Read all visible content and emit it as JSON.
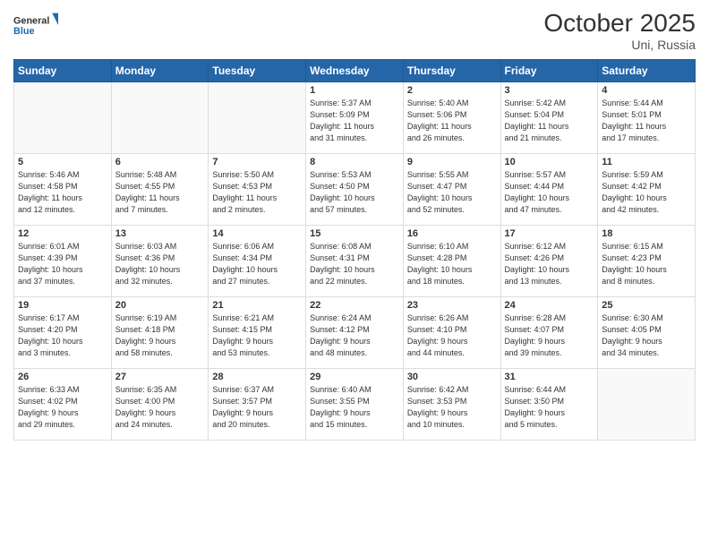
{
  "header": {
    "logo_general": "General",
    "logo_blue": "Blue",
    "month_title": "October 2025",
    "subtitle": "Uni, Russia"
  },
  "weekdays": [
    "Sunday",
    "Monday",
    "Tuesday",
    "Wednesday",
    "Thursday",
    "Friday",
    "Saturday"
  ],
  "weeks": [
    [
      {
        "day": "",
        "info": ""
      },
      {
        "day": "",
        "info": ""
      },
      {
        "day": "",
        "info": ""
      },
      {
        "day": "1",
        "info": "Sunrise: 5:37 AM\nSunset: 5:09 PM\nDaylight: 11 hours\nand 31 minutes."
      },
      {
        "day": "2",
        "info": "Sunrise: 5:40 AM\nSunset: 5:06 PM\nDaylight: 11 hours\nand 26 minutes."
      },
      {
        "day": "3",
        "info": "Sunrise: 5:42 AM\nSunset: 5:04 PM\nDaylight: 11 hours\nand 21 minutes."
      },
      {
        "day": "4",
        "info": "Sunrise: 5:44 AM\nSunset: 5:01 PM\nDaylight: 11 hours\nand 17 minutes."
      }
    ],
    [
      {
        "day": "5",
        "info": "Sunrise: 5:46 AM\nSunset: 4:58 PM\nDaylight: 11 hours\nand 12 minutes."
      },
      {
        "day": "6",
        "info": "Sunrise: 5:48 AM\nSunset: 4:55 PM\nDaylight: 11 hours\nand 7 minutes."
      },
      {
        "day": "7",
        "info": "Sunrise: 5:50 AM\nSunset: 4:53 PM\nDaylight: 11 hours\nand 2 minutes."
      },
      {
        "day": "8",
        "info": "Sunrise: 5:53 AM\nSunset: 4:50 PM\nDaylight: 10 hours\nand 57 minutes."
      },
      {
        "day": "9",
        "info": "Sunrise: 5:55 AM\nSunset: 4:47 PM\nDaylight: 10 hours\nand 52 minutes."
      },
      {
        "day": "10",
        "info": "Sunrise: 5:57 AM\nSunset: 4:44 PM\nDaylight: 10 hours\nand 47 minutes."
      },
      {
        "day": "11",
        "info": "Sunrise: 5:59 AM\nSunset: 4:42 PM\nDaylight: 10 hours\nand 42 minutes."
      }
    ],
    [
      {
        "day": "12",
        "info": "Sunrise: 6:01 AM\nSunset: 4:39 PM\nDaylight: 10 hours\nand 37 minutes."
      },
      {
        "day": "13",
        "info": "Sunrise: 6:03 AM\nSunset: 4:36 PM\nDaylight: 10 hours\nand 32 minutes."
      },
      {
        "day": "14",
        "info": "Sunrise: 6:06 AM\nSunset: 4:34 PM\nDaylight: 10 hours\nand 27 minutes."
      },
      {
        "day": "15",
        "info": "Sunrise: 6:08 AM\nSunset: 4:31 PM\nDaylight: 10 hours\nand 22 minutes."
      },
      {
        "day": "16",
        "info": "Sunrise: 6:10 AM\nSunset: 4:28 PM\nDaylight: 10 hours\nand 18 minutes."
      },
      {
        "day": "17",
        "info": "Sunrise: 6:12 AM\nSunset: 4:26 PM\nDaylight: 10 hours\nand 13 minutes."
      },
      {
        "day": "18",
        "info": "Sunrise: 6:15 AM\nSunset: 4:23 PM\nDaylight: 10 hours\nand 8 minutes."
      }
    ],
    [
      {
        "day": "19",
        "info": "Sunrise: 6:17 AM\nSunset: 4:20 PM\nDaylight: 10 hours\nand 3 minutes."
      },
      {
        "day": "20",
        "info": "Sunrise: 6:19 AM\nSunset: 4:18 PM\nDaylight: 9 hours\nand 58 minutes."
      },
      {
        "day": "21",
        "info": "Sunrise: 6:21 AM\nSunset: 4:15 PM\nDaylight: 9 hours\nand 53 minutes."
      },
      {
        "day": "22",
        "info": "Sunrise: 6:24 AM\nSunset: 4:12 PM\nDaylight: 9 hours\nand 48 minutes."
      },
      {
        "day": "23",
        "info": "Sunrise: 6:26 AM\nSunset: 4:10 PM\nDaylight: 9 hours\nand 44 minutes."
      },
      {
        "day": "24",
        "info": "Sunrise: 6:28 AM\nSunset: 4:07 PM\nDaylight: 9 hours\nand 39 minutes."
      },
      {
        "day": "25",
        "info": "Sunrise: 6:30 AM\nSunset: 4:05 PM\nDaylight: 9 hours\nand 34 minutes."
      }
    ],
    [
      {
        "day": "26",
        "info": "Sunrise: 6:33 AM\nSunset: 4:02 PM\nDaylight: 9 hours\nand 29 minutes."
      },
      {
        "day": "27",
        "info": "Sunrise: 6:35 AM\nSunset: 4:00 PM\nDaylight: 9 hours\nand 24 minutes."
      },
      {
        "day": "28",
        "info": "Sunrise: 6:37 AM\nSunset: 3:57 PM\nDaylight: 9 hours\nand 20 minutes."
      },
      {
        "day": "29",
        "info": "Sunrise: 6:40 AM\nSunset: 3:55 PM\nDaylight: 9 hours\nand 15 minutes."
      },
      {
        "day": "30",
        "info": "Sunrise: 6:42 AM\nSunset: 3:53 PM\nDaylight: 9 hours\nand 10 minutes."
      },
      {
        "day": "31",
        "info": "Sunrise: 6:44 AM\nSunset: 3:50 PM\nDaylight: 9 hours\nand 5 minutes."
      },
      {
        "day": "",
        "info": ""
      }
    ]
  ]
}
